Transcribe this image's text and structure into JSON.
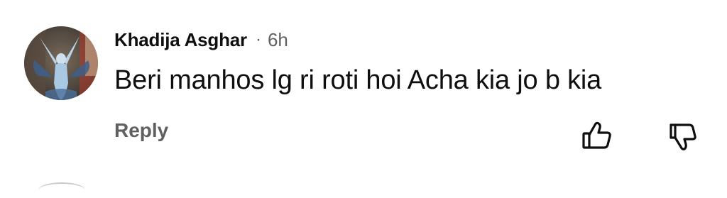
{
  "comment": {
    "author": "Khadija Asghar",
    "separator": "·",
    "time": "6h",
    "text": "Beri manhos lg ri roti hoi Acha kia jo b kia",
    "reply_label": "Reply"
  },
  "icons": {
    "like": "thumbs-up-icon",
    "dislike": "thumbs-down-icon"
  },
  "colors": {
    "primary_text": "#0f0f0f",
    "secondary_text": "#606060",
    "background": "#ffffff"
  }
}
